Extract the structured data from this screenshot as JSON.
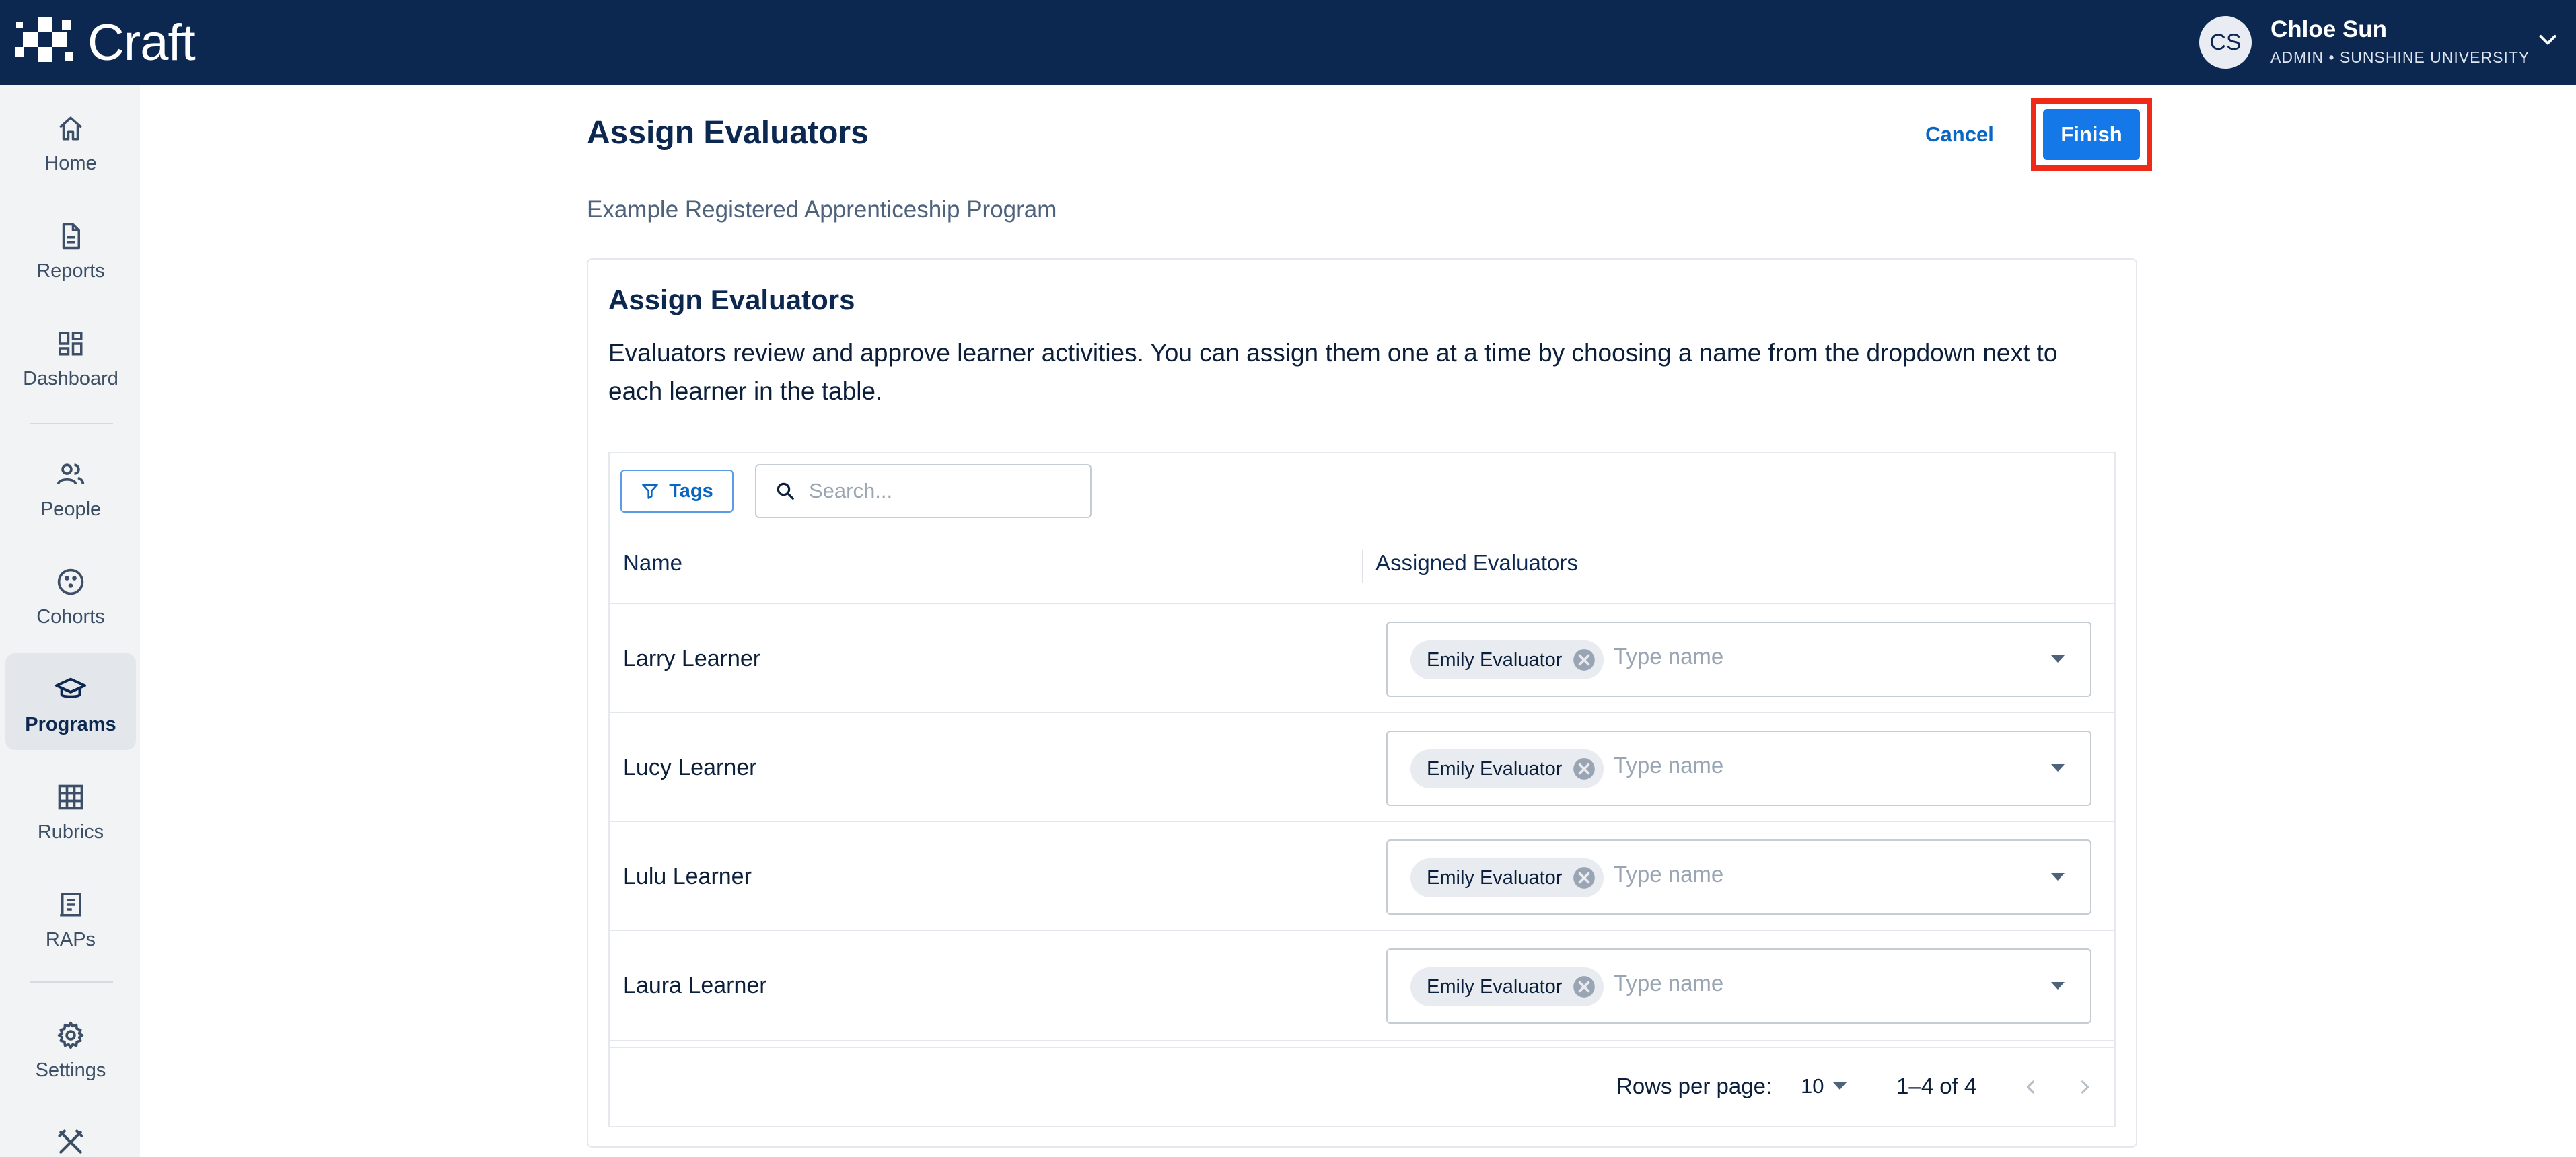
{
  "brand": {
    "name": "Craft"
  },
  "user": {
    "initials": "CS",
    "name": "Chloe Sun",
    "role": "ADMIN • SUNSHINE UNIVERSITY"
  },
  "sidebar": {
    "items": [
      {
        "label": "Home",
        "icon": "home-icon"
      },
      {
        "label": "Reports",
        "icon": "document-icon"
      },
      {
        "label": "Dashboard",
        "icon": "dashboard-icon"
      },
      {
        "label": "People",
        "icon": "people-icon"
      },
      {
        "label": "Cohorts",
        "icon": "cohorts-icon"
      },
      {
        "label": "Programs",
        "icon": "graduation-cap-icon",
        "active": true
      },
      {
        "label": "Rubrics",
        "icon": "grid-icon"
      },
      {
        "label": "RAPs",
        "icon": "notebook-icon"
      },
      {
        "label": "Settings",
        "icon": "gear-icon"
      },
      {
        "label": "",
        "icon": "tools-icon"
      }
    ]
  },
  "header": {
    "title": "Assign Evaluators",
    "cancel_label": "Cancel",
    "finish_label": "Finish",
    "program": "Example Registered Apprenticeship Program"
  },
  "card": {
    "title": "Assign Evaluators",
    "description": "Evaluators review and approve learner activities. You can assign them one at a time by choosing a name from the dropdown next to each learner in the table."
  },
  "table": {
    "tags_label": "Tags",
    "search_placeholder": "Search...",
    "columns": [
      "Name",
      "Assigned Evaluators"
    ],
    "rows": [
      {
        "name": "Larry Learner",
        "evaluator": "Emily Evaluator",
        "input_placeholder": "Type name"
      },
      {
        "name": "Lucy Learner",
        "evaluator": "Emily Evaluator",
        "input_placeholder": "Type name"
      },
      {
        "name": "Lulu Learner",
        "evaluator": "Emily Evaluator",
        "input_placeholder": "Type name"
      },
      {
        "name": "Laura Learner",
        "evaluator": "Emily Evaluator",
        "input_placeholder": "Type name"
      }
    ]
  },
  "pagination": {
    "rows_per_page_label": "Rows per page:",
    "rows_per_page": "10",
    "range": "1–4 of 4"
  },
  "colors": {
    "topbar": "#0c2850",
    "primary": "#1478e8",
    "link": "#0a66c2",
    "highlight": "#ee2a19"
  }
}
